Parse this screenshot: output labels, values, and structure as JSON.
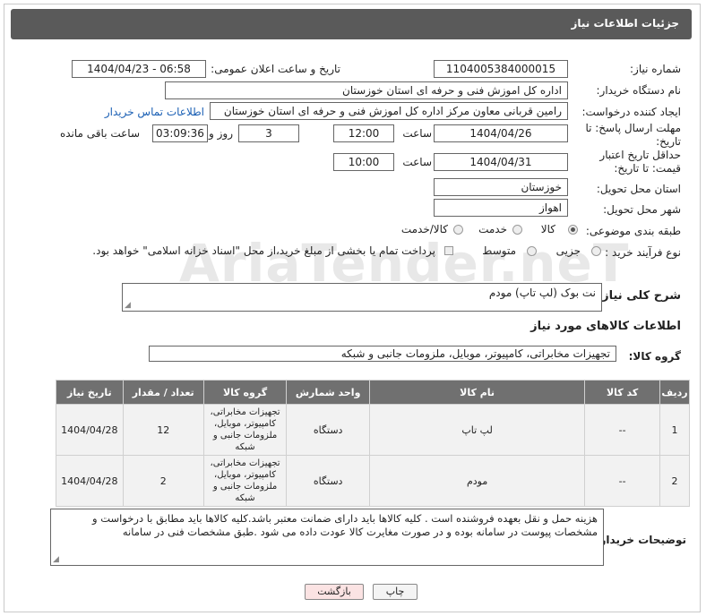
{
  "header": {
    "title": "جزئیات اطلاعات نیاز"
  },
  "fields": {
    "need_number_label": "شماره نیاز:",
    "need_number": "1104005384000015",
    "announce_label": "تاریخ و ساعت اعلان عمومی:",
    "announce_value": "1404/04/23 - 06:58",
    "buyer_label": "نام دستگاه خریدار:",
    "buyer_value": "اداره کل اموزش فنی و حرفه ای استان خوزستان",
    "creator_label": "ایجاد کننده درخواست:",
    "creator_value": "رامین قربانی معاون مرکز  اداره کل اموزش فنی و حرفه ای استان خوزستان",
    "contact_link": "اطلاعات تماس خریدار",
    "deadline_label": "مهلت ارسال پاسخ: تا تاریخ:",
    "deadline_date": "1404/04/26",
    "time_label": "ساعت",
    "deadline_time": "12:00",
    "days_value": "3",
    "days_label": "روز و",
    "remaining_value": "03:09:36",
    "remaining_label": "ساعت باقی مانده",
    "price_valid_label": "حداقل تاریخ اعتبار قیمت: تا تاریخ:",
    "price_valid_date": "1404/04/31",
    "price_valid_time": "10:00",
    "province_label": "استان محل تحویل:",
    "province_value": "خوزستان",
    "city_label": "شهر محل تحویل:",
    "city_value": "اهواز",
    "category_label": "طبقه بندی موضوعی:",
    "category_options": [
      "کالا",
      "خدمت",
      "کالا/خدمت"
    ],
    "process_label": "نوع فرآیند خرید :",
    "process_options": [
      "جزیی",
      "متوسط"
    ],
    "payment_note": "پرداخت تمام یا بخشی از مبلغ خرید،از محل \"اسناد خزانه اسلامی\" خواهد بود.",
    "description_label": "شرح کلی نیاز:",
    "description_value": "نت بوک (لپ تاپ) مودم",
    "goods_info_title": "اطلاعات کالاهای مورد نیاز",
    "goods_group_label": "گروه کالا:",
    "goods_group_value": "تجهیزات مخابراتی، کامپیوتر، موبایل، ملزومات جانبی و شبکه",
    "buyer_notes_label": "توضیحات خریدار:",
    "buyer_notes_value": "هزینه حمل و نقل بعهده فروشنده است . کلیه کالاها باید دارای ضمانت معتبر باشد.کلیه کالاها باید مطابق با درخواست و مشخصات پیوست در سامانه بوده و در صورت مغایرت کالا عودت داده می شود .طبق مشخصات فنی در سامانه"
  },
  "table": {
    "headers": [
      "ردیف",
      "کد کالا",
      "نام کالا",
      "واحد شمارش",
      "گروه کالا",
      "تعداد / مقدار",
      "تاریخ نیاز"
    ],
    "rows": [
      {
        "row": "1",
        "code": "--",
        "name": "لپ تاپ",
        "unit": "دستگاه",
        "group": "تجهیزات مخابراتی، کامپیوتر، موبایل، ملزومات جانبی و شبکه",
        "qty": "12",
        "date": "1404/04/28"
      },
      {
        "row": "2",
        "code": "--",
        "name": "مودم",
        "unit": "دستگاه",
        "group": "تجهیزات مخابراتی، کامپیوتر، موبایل، ملزومات جانبی و شبکه",
        "qty": "2",
        "date": "1404/04/28"
      }
    ]
  },
  "buttons": {
    "print": "چاپ",
    "back": "بازگشت"
  },
  "watermark": "AriaTender.neT"
}
